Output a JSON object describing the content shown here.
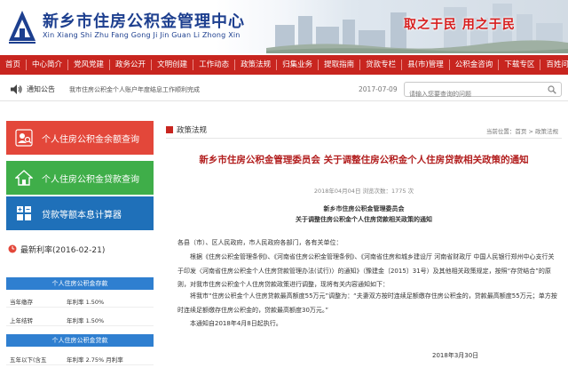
{
  "header": {
    "title": "新乡市住房公积金管理中心",
    "subtitle": "Xin Xiang Shi Zhu Fang Gong Ji Jin Guan Li Zhong Xin",
    "slogan": "取之于民  用之于民"
  },
  "nav": [
    "首页",
    "中心简介",
    "党风党建",
    "政务公开",
    "文明创建",
    "工作动态",
    "政策法规",
    "归集业务",
    "提取指南",
    "贷款专栏",
    "县(市)管理",
    "公积金咨询",
    "下载专区",
    "百姓问题"
  ],
  "notice": {
    "label": "通知公告",
    "text": "我市住房公积金个人账户年度结息工作顺利完成",
    "date": "2017-07-09"
  },
  "search": {
    "placeholder": "请输入您要查询的问题"
  },
  "sidebar": {
    "tools": [
      {
        "label": "个人住房公积金余额查询",
        "icon": "person-query-icon"
      },
      {
        "label": "个人住房公积金贷款查询",
        "icon": "house-loan-icon"
      },
      {
        "label": "贷款等额本息计算器",
        "icon": "calculator-icon"
      }
    ],
    "rates": {
      "title": "最新利率(2016-02-21)",
      "deposit_title": "个人住房公积金存款",
      "deposit_rows": [
        {
          "k": "当年缴存",
          "v": "年利率 1.50%"
        },
        {
          "k": "上年结转",
          "v": "年利率 1.50%"
        }
      ],
      "loan_title": "个人住房公积金贷款",
      "loan_rows": [
        {
          "k": "五年以下(含五",
          "v": "年利率 2.75% 月利率"
        }
      ]
    }
  },
  "main": {
    "tab": "政策法规",
    "breadcrumb": "当前位置：首页 > 政策法规",
    "title": "新乡市住房公积金管理委员会 关于调整住房公积金个人住房贷款相关政策的通知",
    "meta": "2018年04月04日  浏览次数：1775 次",
    "doc_org": "新乡市住房公积金管理委员会",
    "doc_subject": "关于调整住房公积金个人住房贷款相关政策的通知",
    "p1": "各县（市）、区人民政府，市人民政府各部门，各有关单位：",
    "p2": "根据《住房公积金管理条例》、《河南省住房公积金管理条例》、《河南省住房和城乡建设厅 河南省财政厅 中国人民银行郑州中心支行关于印发〈河南省住房公积金个人住房贷款管理办法(试行)〉的通知》（豫建金〔2015〕31号）及其他相关政策规定，按照“存贷结合”的原则，对我市住房公积金个人住房贷款政策进行调整，现将有关内容通知如下：",
    "p3": "将我市“住房公积金个人住房贷款最高额度55万元”调整为：“夫妻双方按时连续足额缴存住房公积金的，贷款最高额度55万元；单方按时连续足额缴存住房公积金的，贷款最高额度30万元。”",
    "p4": "本通知自2018年4月8日起执行。",
    "sign_date": "2018年3月30日"
  },
  "colors": {
    "nav_red": "#c8251f",
    "title_blue": "#1d3f8f",
    "query_red": "#e3473a",
    "loan_green": "#3fae49",
    "calc_blue": "#1f70b9",
    "rate_blue": "#2f7fd0",
    "article_red": "#b21e1e"
  }
}
